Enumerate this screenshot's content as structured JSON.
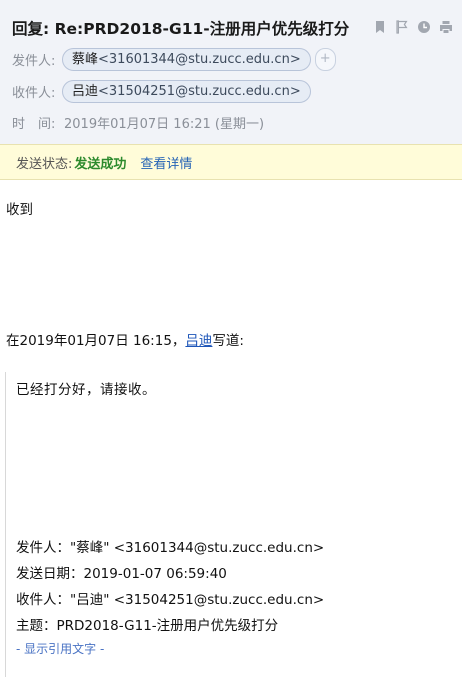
{
  "email": {
    "subject": "回复: Re:PRD2018-G11-注册用户优先级打分",
    "from_label": "发件人:",
    "from_name": "蔡峰",
    "from_addr": "<31601344@stu.zucc.edu.cn>",
    "add_contact": "+",
    "to_label": "收件人:",
    "to_name": "吕迪",
    "to_addr": "<31504251@stu.zucc.edu.cn>",
    "time_label": "时　间:",
    "time_value": "2019年01月07日 16:21 (星期一)"
  },
  "header_icons": [
    "bookmark-icon",
    "flag-icon",
    "clock-icon",
    "print-icon"
  ],
  "status": {
    "label": "发送状态:",
    "value": "发送成功",
    "details_link": "查看详情"
  },
  "body": {
    "reply": "收到",
    "quote_intro_prefix": "在2019年01月07日 16:15，",
    "quote_intro_name": "吕迪",
    "quote_intro_suffix": "写道:"
  },
  "quoted": {
    "message": "已经打分好，请接收。",
    "from_line": "发件人：\"蔡峰\" <31601344@stu.zucc.edu.cn>",
    "date_line": "发送日期：2019-01-07 06:59:40",
    "to_line": "收件人：\"吕迪\" <31504251@stu.zucc.edu.cn>",
    "subject_line": "主题：PRD2018-G11-注册用户优先级打分",
    "toggle": "- 显示引用文字 -"
  },
  "colors": {
    "header_bg": "#f1f3f8",
    "status_bg": "#fffcd9",
    "success": "#2c8a2c",
    "link": "#2563b5"
  }
}
